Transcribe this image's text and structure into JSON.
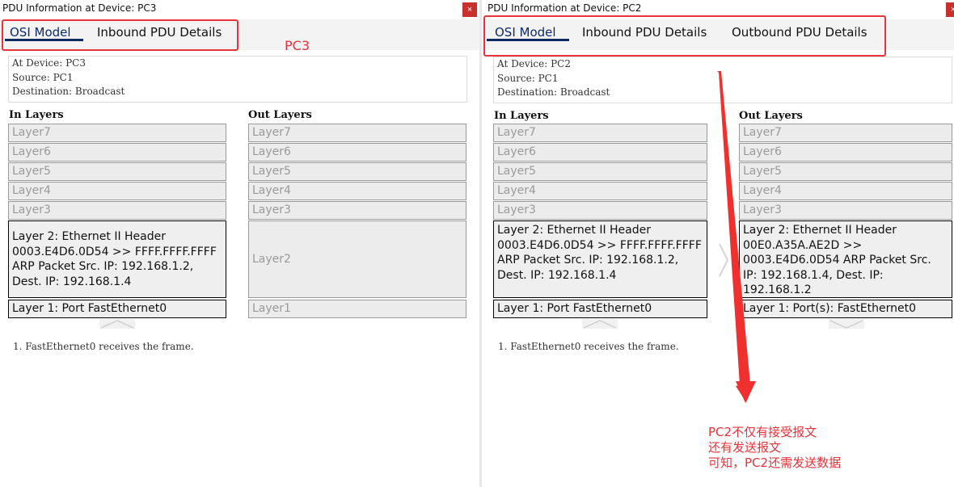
{
  "pc3_window": {
    "title": "PDU Information at Device: PC3",
    "close_label": "×",
    "tabs": [
      {
        "label": "OSI Model",
        "active": true
      },
      {
        "label": "Inbound PDU Details",
        "active": false
      }
    ],
    "info": {
      "device": "At Device: PC3",
      "source": "Source: PC1",
      "destination": "Destination: Broadcast"
    },
    "in_layers_header": "In Layers",
    "out_layers_header": "Out Layers",
    "in_layers": {
      "layer7": "Layer7",
      "layer6": "Layer6",
      "layer5": "Layer5",
      "layer4": "Layer4",
      "layer3": "Layer3",
      "layer2": "Layer 2: Ethernet II Header 0003.E4D6.0D54 >> FFFF.FFFF.FFFF ARP Packet Src. IP: 192.168.1.2, Dest. IP: 192.168.1.4",
      "layer1": "Layer 1: Port FastEthernet0"
    },
    "out_layers": {
      "layer7": "Layer7",
      "layer6": "Layer6",
      "layer5": "Layer5",
      "layer4": "Layer4",
      "layer3": "Layer3",
      "layer2": "Layer2",
      "layer1": "Layer1"
    },
    "steps": [
      "1. FastEthernet0 receives the frame."
    ]
  },
  "pc2_window": {
    "title": "PDU Information at Device: PC2",
    "close_label": "×",
    "tabs": [
      {
        "label": "OSI Model",
        "active": true
      },
      {
        "label": "Inbound PDU Details",
        "active": false
      },
      {
        "label": "Outbound PDU Details",
        "active": false
      }
    ],
    "info": {
      "device": "At Device: PC2",
      "source": "Source: PC1",
      "destination": "Destination: Broadcast"
    },
    "in_layers_header": "In Layers",
    "out_layers_header": "Out Layers",
    "in_layers": {
      "layer7": "Layer7",
      "layer6": "Layer6",
      "layer5": "Layer5",
      "layer4": "Layer4",
      "layer3": "Layer3",
      "layer2": "Layer 2: Ethernet II Header 0003.E4D6.0D54 >> FFFF.FFFF.FFFF ARP Packet Src. IP: 192.168.1.2, Dest. IP: 192.168.1.4",
      "layer1": "Layer 1: Port FastEthernet0"
    },
    "out_layers": {
      "layer7": "Layer7",
      "layer6": "Layer6",
      "layer5": "Layer5",
      "layer4": "Layer4",
      "layer3": "Layer3",
      "layer2": "Layer 2: Ethernet II Header 00E0.A35A.AE2D >> 0003.E4D6.0D54 ARP Packet Src. IP: 192.168.1.4, Dest. IP: 192.168.1.2",
      "layer1": "Layer 1: Port(s): FastEthernet0"
    },
    "steps": [
      "1. FastEthernet0 receives the frame."
    ]
  },
  "annotations": {
    "pc3_label": "PC3",
    "note_lines": [
      "PC2不仅有接受报文",
      "还有发送报文",
      "可知，PC2还需发送数据"
    ],
    "color": "#e8323c"
  }
}
